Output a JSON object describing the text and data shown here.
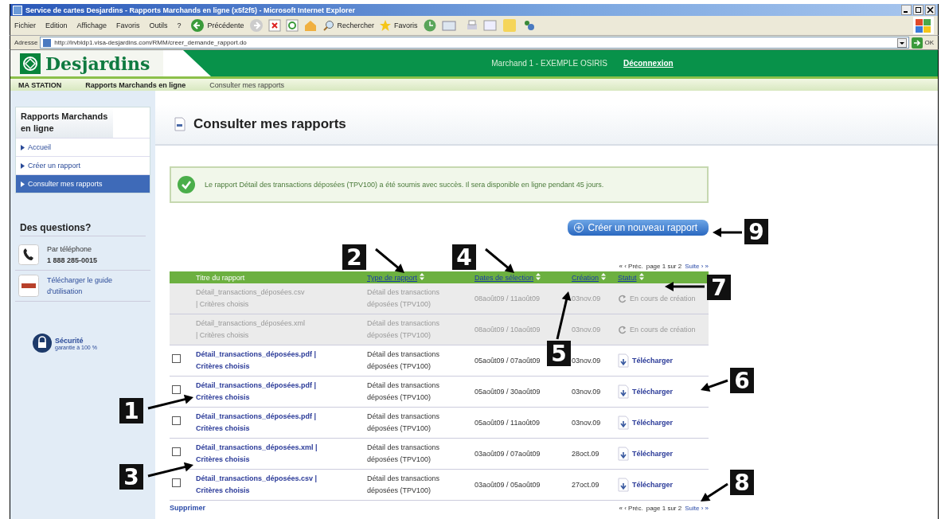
{
  "window": {
    "title": "Service de cartes Desjardins - Rapports Marchands en ligne (x5f2f5) - Microsoft Internet Explorer"
  },
  "menu": [
    "Fichier",
    "Edition",
    "Affichage",
    "Favoris",
    "Outils",
    "?"
  ],
  "toolbar": {
    "back": "Précédente",
    "search": "Rechercher",
    "favorites": "Favoris"
  },
  "address": {
    "label": "Adresse",
    "value": "http://lrvbldp1.visa-desjardins.com/RMM/creer_demande_rapport.do",
    "go": "OK"
  },
  "header": {
    "logo": "Desjardins",
    "user": "Marchand 1 - EXEMPLE OSIRIS",
    "logout": "Déconnexion"
  },
  "breadcrumb": [
    "MA STATION",
    "Rapports Marchands en ligne",
    "Consulter mes rapports"
  ],
  "sidebar": {
    "title": "Rapports Marchands en ligne",
    "items": [
      {
        "label": "Accueil",
        "selected": false
      },
      {
        "label": "Créer un rapport",
        "selected": false
      },
      {
        "label": "Consulter mes rapports",
        "selected": true
      }
    ],
    "questions": "Des questions?",
    "phone_label": "Par téléphone",
    "phone": "1 888 285-0015",
    "guide": "Télécharger le guide d'utilisation",
    "security": "Sécurité",
    "security_note": "garantie à 100 %"
  },
  "main": {
    "title": "Consulter mes rapports",
    "message": "Le rapport Détail des transactions déposées (TPV100) a été soumis avec succès. Il sera disponible en ligne pendant 45 jours.",
    "create_button": "Créer un nouveau rapport",
    "pager": {
      "prev": "« ‹ Préc.",
      "page": "page 1 sur 2",
      "next": "Suite › »"
    },
    "columns": [
      {
        "label": "Titre du rapport",
        "sortable": false
      },
      {
        "label": "Type de rapport",
        "sortable": true
      },
      {
        "label": "Dates de sélection",
        "sortable": true
      },
      {
        "label": "Création",
        "sortable": true
      },
      {
        "label": "Statut",
        "sortable": true
      }
    ],
    "rows": [
      {
        "kind": "pending",
        "title": "Détail_transactions_déposées.csv",
        "criteria": "| Critères choisis",
        "type": "Détail des transactions déposées (TPV100)",
        "dates": "08août09 / 11août09",
        "created": "03nov.09",
        "status": "En cours de création"
      },
      {
        "kind": "pending",
        "title": "Détail_transactions_déposées.xml",
        "criteria": "| Critères choisis",
        "type": "Détail des transactions déposées (TPV100)",
        "dates": "08août09 / 10août09",
        "created": "03nov.09",
        "status": "En cours de création"
      },
      {
        "kind": "ready",
        "checked": false,
        "title": "Détail_transactions_déposées.pdf |",
        "criteria": "Critères choisis",
        "type": "Détail des transactions déposées (TPV100)",
        "dates": "05août09 / 07août09",
        "created": "03nov.09",
        "status": "Télécharger"
      },
      {
        "kind": "ready",
        "checked": false,
        "title": "Détail_transactions_déposées.pdf |",
        "criteria": "Critères choisis",
        "type": "Détail des transactions déposées (TPV100)",
        "dates": "05août09 / 30août09",
        "created": "03nov.09",
        "status": "Télécharger"
      },
      {
        "kind": "ready",
        "checked": false,
        "title": "Détail_transactions_déposées.pdf |",
        "criteria": "Critères choisis",
        "type": "Détail des transactions déposées (TPV100)",
        "dates": "05août09 / 11août09",
        "created": "03nov.09",
        "status": "Télécharger"
      },
      {
        "kind": "ready",
        "checked": false,
        "title": "Détail_transactions_déposées.xml |",
        "criteria": "Critères choisis",
        "type": "Détail des transactions déposées (TPV100)",
        "dates": "03août09 / 07août09",
        "created": "28oct.09",
        "status": "Télécharger"
      },
      {
        "kind": "ready",
        "checked": false,
        "title": "Détail_transactions_déposées.csv |",
        "criteria": "Critères choisis",
        "type": "Détail des transactions déposées (TPV100)",
        "dates": "03août09 / 05août09",
        "created": "27oct.09",
        "status": "Télécharger"
      }
    ],
    "delete": "Supprimer",
    "pager_bottom": {
      "prev": "« ‹ Préc.",
      "page": "page 1 sur 2",
      "next": "Suite › »"
    }
  },
  "callouts": [
    "1",
    "2",
    "3",
    "4",
    "5",
    "6",
    "7",
    "8",
    "9"
  ]
}
